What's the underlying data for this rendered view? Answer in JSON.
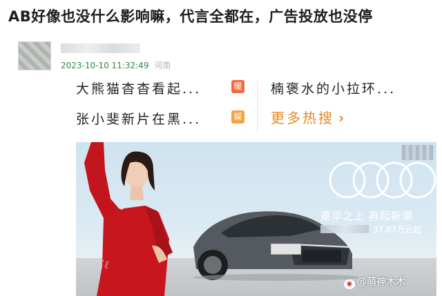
{
  "post": {
    "headline": "AB好像也没什么影响嘛，代言全都在，广告投放也没停",
    "time": "2023-10-10 11:32:49",
    "location": "河南"
  },
  "hot_search": {
    "items": [
      {
        "text": "大熊猫杳杳看起...",
        "badge": "暖",
        "badge_color": "#f26a3d"
      },
      {
        "text": "楠褒水的小拉环...",
        "badge": "",
        "badge_color": ""
      },
      {
        "text": "张小斐新片在黑...",
        "badge": "娱",
        "badge_color": "#f4a340"
      }
    ],
    "more_label": "更多热搜",
    "more_icon": "chevron-right-icon"
  },
  "ad": {
    "slogan": "豪华之上  再起新潮",
    "price": "37.87万元起",
    "brand_logo": "four-rings-logo",
    "signature": "signature"
  },
  "watermark": {
    "text": "@萌神木木",
    "icon": "weibo-icon"
  }
}
